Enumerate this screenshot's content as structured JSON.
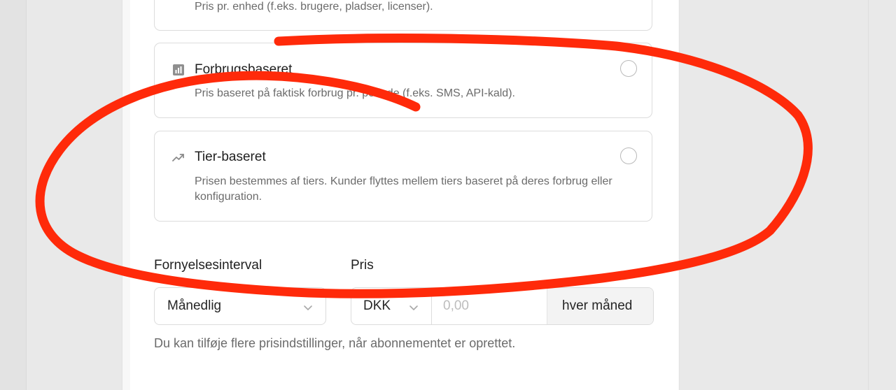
{
  "options": [
    {
      "title": "",
      "description": "Pris pr. enhed (f.eks. brugere, pladser, licenser).",
      "icon": "users-icon"
    },
    {
      "title": "Forbrugsbaseret",
      "description": "Pris baseret på faktisk forbrug pr. periode (f.eks. SMS, API-kald).",
      "icon": "bar-chart-icon"
    },
    {
      "title": "Tier-baseret",
      "description": "Prisen bestemmes af tiers. Kunder flyttes mellem tiers baseret på deres forbrug eller konfiguration.",
      "icon": "trending-up-icon"
    }
  ],
  "renewal": {
    "label": "Fornyelsesinterval",
    "value": "Månedlig"
  },
  "price": {
    "label": "Pris",
    "currency": "DKK",
    "amount_placeholder": "0,00",
    "suffix": "hver måned"
  },
  "help_text": "Du kan tilføje flere prisindstillinger, når abonnementet er oprettet.",
  "colors": {
    "annotation": "#ff2a0a",
    "text_primary": "#1f1f1f",
    "text_muted": "#6b6b6b",
    "border": "#dcdcdc"
  }
}
